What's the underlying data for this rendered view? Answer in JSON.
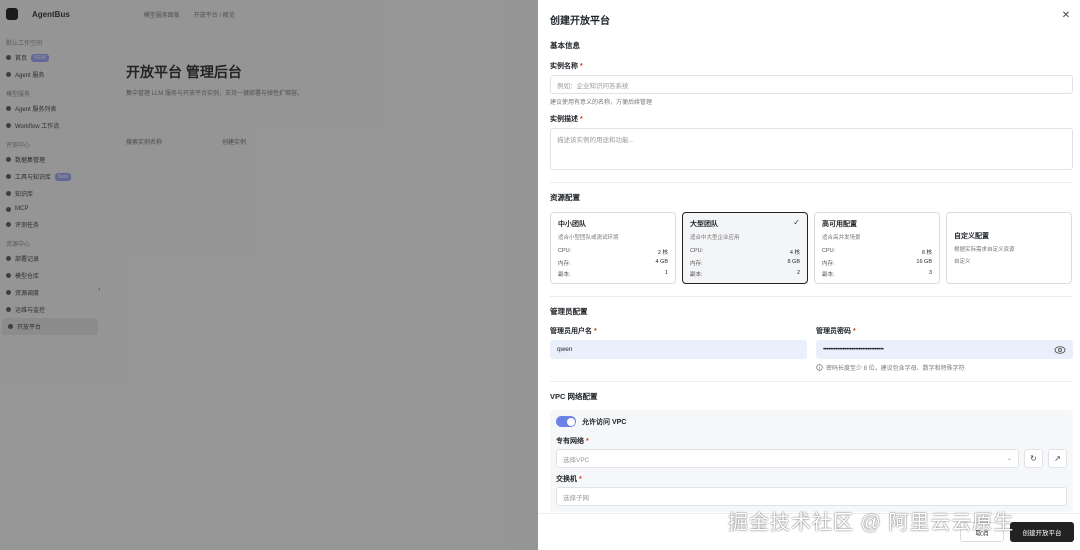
{
  "background": {
    "brand": "AgentBus",
    "crumbs": [
      "模型服务面板",
      "开放平台 / 概览"
    ],
    "sidebar": {
      "top_label": "默认工作空间",
      "items": [
        {
          "label": "首页",
          "badge": "NEW"
        },
        {
          "label": "Agent 服务"
        },
        {
          "heading": "模型服务"
        },
        {
          "label": "Agent 服务列表"
        },
        {
          "label": "Workflow 工作流"
        },
        {
          "heading": "评测中心"
        },
        {
          "label": "数据集管理"
        },
        {
          "label": "工具与知识库",
          "badge": "Beta"
        },
        {
          "label": "知识库"
        },
        {
          "label": "MCP"
        },
        {
          "label": "评测任务"
        },
        {
          "heading": "资源中心"
        },
        {
          "label": "部署记录"
        },
        {
          "label": "模型仓库"
        },
        {
          "label": "资源调度"
        },
        {
          "label": "运维与监控"
        },
        {
          "label": "开放平台",
          "active": true
        }
      ]
    },
    "main": {
      "title": "开放平台 管理后台",
      "description": "集中管理 LLM 服务与开放平台实例，支持一键部署与弹性扩缩容。",
      "toolbar": [
        "搜索实例名称",
        "创建实例"
      ]
    }
  },
  "drawer": {
    "title": "创建开放平台",
    "basic": {
      "section_title": "基本信息",
      "name_label": "实例名称",
      "name_placeholder": "例如：企业知识问答系统",
      "name_hint": "建议使用有意义的名称，方便后续管理",
      "desc_label": "实例描述",
      "desc_placeholder": "描述该实例的用途和功能..."
    },
    "resources": {
      "section_title": "资源配置",
      "cards": [
        {
          "name": "中小团队",
          "sub": "适合小型团队或测试环境",
          "rows": [
            [
              "CPU:",
              "2 核"
            ],
            [
              "内存:",
              "4 GB"
            ],
            [
              "副本:",
              "1"
            ]
          ],
          "selected": false
        },
        {
          "name": "大型团队",
          "sub": "适合中大型企业应用",
          "rows": [
            [
              "CPU:",
              "4 核"
            ],
            [
              "内存:",
              "8 GB"
            ],
            [
              "副本:",
              "2"
            ]
          ],
          "selected": true
        },
        {
          "name": "高可用配置",
          "sub": "适合高并发场景",
          "rows": [
            [
              "CPU:",
              "8 核"
            ],
            [
              "内存:",
              "16 GB"
            ],
            [
              "副本:",
              "3"
            ]
          ],
          "selected": false
        },
        {
          "name": "自定义配置",
          "sub": "根据实际需求自定义资源",
          "extra": "自定义",
          "selected": false
        }
      ]
    },
    "admin": {
      "section_title": "管理员配置",
      "username_label": "管理员用户名",
      "username_value": "qwen",
      "password_label": "管理员密码",
      "password_value": "••••••••••••••••••••••••••••••••••",
      "password_hint": "密码长度至少 8 位，建议包含字母、数字和特殊字符"
    },
    "vpc": {
      "section_title": "VPC 网络配置",
      "toggle_label": "允许访问 VPC",
      "toggle_on": true,
      "vpc_label": "专有网络",
      "vpc_placeholder": "选择VPC",
      "switch_label": "交换机",
      "switch_placeholder": "选择子网"
    },
    "footer": {
      "cancel_label": "取消",
      "submit_label": "创建开放平台"
    }
  },
  "watermark": "掘金技术社区 @ 阿里云云原生",
  "colors": {
    "accent": "#6b82e6",
    "primary_button": "#222222",
    "filled_input": "#eaf0fb",
    "required": "#d4380d"
  }
}
